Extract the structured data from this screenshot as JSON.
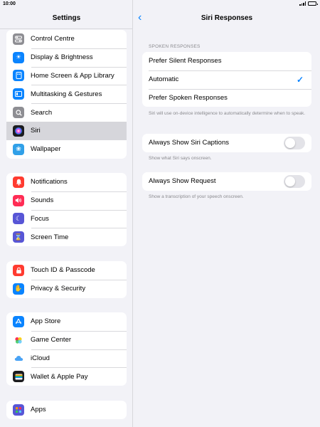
{
  "status": {
    "time": "10:00"
  },
  "sidebar": {
    "title": "Settings",
    "groups": [
      {
        "items": [
          {
            "label": "Control Centre",
            "icon": "control-centre-icon",
            "color": "#8e8e93"
          },
          {
            "label": "Display & Brightness",
            "icon": "sun-icon",
            "color": "#0a84ff"
          },
          {
            "label": "Home Screen & App Library",
            "icon": "home-screen-icon",
            "color": "#0a84ff"
          },
          {
            "label": "Multitasking & Gestures",
            "icon": "multitasking-icon",
            "color": "#0a84ff"
          },
          {
            "label": "Search",
            "icon": "search-icon",
            "color": "#8e8e93"
          },
          {
            "label": "Siri",
            "icon": "siri-icon",
            "color": "#1c1c1e",
            "selected": true
          },
          {
            "label": "Wallpaper",
            "icon": "wallpaper-icon",
            "color": "#30a0e8"
          }
        ]
      },
      {
        "items": [
          {
            "label": "Notifications",
            "icon": "bell-icon",
            "color": "#ff3b30"
          },
          {
            "label": "Sounds",
            "icon": "speaker-icon",
            "color": "#ff2d55"
          },
          {
            "label": "Focus",
            "icon": "moon-icon",
            "color": "#5856d6"
          },
          {
            "label": "Screen Time",
            "icon": "hourglass-icon",
            "color": "#5856d6"
          }
        ]
      },
      {
        "items": [
          {
            "label": "Touch ID & Passcode",
            "icon": "lock-icon",
            "color": "#ff3b30"
          },
          {
            "label": "Privacy & Security",
            "icon": "hand-icon",
            "color": "#0a84ff"
          }
        ]
      },
      {
        "items": [
          {
            "label": "App Store",
            "icon": "app-store-icon",
            "color": "#0a84ff"
          },
          {
            "label": "Game Center",
            "icon": "game-center-icon",
            "color": "#ffffff"
          },
          {
            "label": "iCloud",
            "icon": "cloud-icon",
            "color": "#ffffff"
          },
          {
            "label": "Wallet & Apple Pay",
            "icon": "wallet-icon",
            "color": "#1c1c1e"
          }
        ]
      },
      {
        "items": [
          {
            "label": "Apps",
            "icon": "apps-icon",
            "color": "#5856d6"
          }
        ]
      }
    ]
  },
  "detail": {
    "title": "Siri Responses",
    "spoken": {
      "header": "SPOKEN RESPONSES",
      "options": [
        "Prefer Silent Responses",
        "Automatic",
        "Prefer Spoken Responses"
      ],
      "selected_index": 1,
      "footer": "Siri will use on-device intelligence to automatically determine when to speak."
    },
    "captions": {
      "label": "Always Show Siri Captions",
      "on": false,
      "footer": "Show what Siri says onscreen."
    },
    "request": {
      "label": "Always Show Request",
      "on": false,
      "footer": "Show a transcription of your speech onscreen."
    }
  },
  "colors": {
    "accent": "#0a84ff",
    "background": "#f2f2f7",
    "toggle_off": "#e3e3e8"
  }
}
